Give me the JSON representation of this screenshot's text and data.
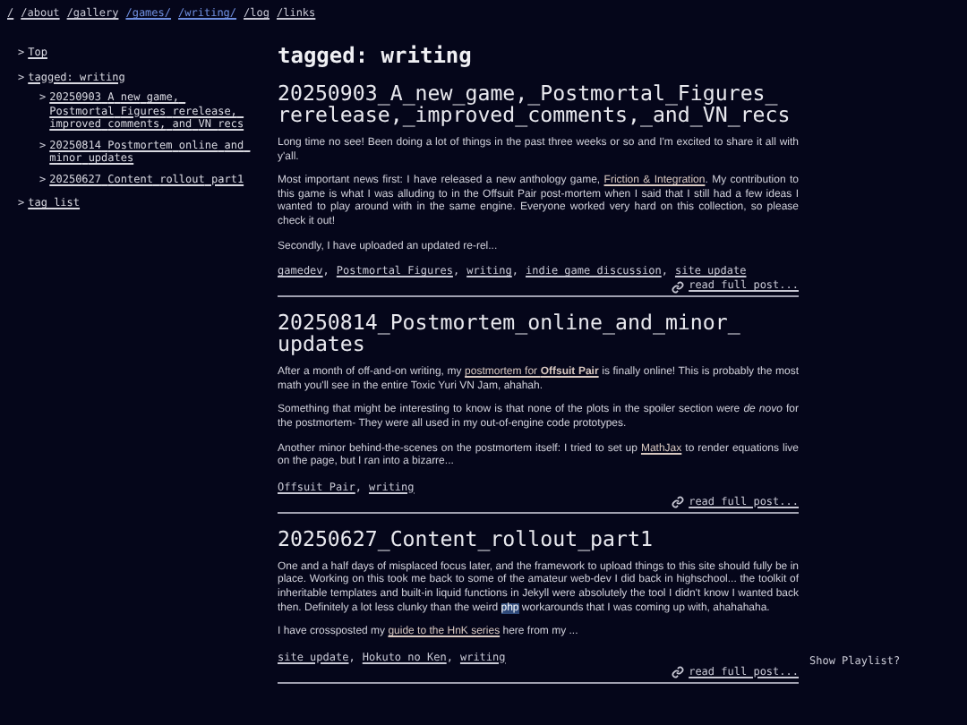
{
  "nav": [
    {
      "label": "/",
      "current": false
    },
    {
      "label": "/about",
      "current": false
    },
    {
      "label": "/gallery",
      "current": false
    },
    {
      "label": "/games/",
      "current": true
    },
    {
      "label": "/writing/",
      "current": true
    },
    {
      "label": "/log",
      "current": false
    },
    {
      "label": "/links",
      "current": false
    }
  ],
  "sidebar": {
    "items": [
      {
        "marker": ">",
        "label": "Top"
      },
      {
        "marker": ">",
        "label": "tagged: writing",
        "children": [
          {
            "marker": ">",
            "label": "20250903_A_new_game,_Postmortal_Figures_rerelease,_improved_comments,_and_VN_recs"
          },
          {
            "marker": ">",
            "label": "20250814_Postmortem_online_and_minor_updates"
          },
          {
            "marker": ">",
            "label": "20250627_Content_rollout_part1"
          }
        ]
      },
      {
        "marker": ">",
        "label": "tag list"
      }
    ]
  },
  "heading": "tagged: writing",
  "posts": [
    {
      "title": "20250903_A_new_game,_Postmortal_Figures_rerelease,_improved_comments,_and_VN_recs",
      "paragraphs": [
        [
          {
            "kind": "text",
            "text": "Long time no see! Been doing a lot of things in the past three weeks or so and I'm excited to share it all with y'all."
          }
        ],
        [
          {
            "kind": "text",
            "text": "Most important news first: I have released a new anthology game, "
          },
          {
            "kind": "link",
            "text": "Friction & Integration"
          },
          {
            "kind": "text",
            "text": ". My contribution to this game is what I was alluding to in the Offsuit Pair post-mortem when I said that I still had a few ideas I wanted to play around with in the same engine. Everyone worked very hard on this collection, so please check it out!"
          }
        ],
        [
          {
            "kind": "text",
            "text": "Secondly, I have uploaded an updated re-rel..."
          }
        ]
      ],
      "tags": [
        "gamedev",
        "Postmortal Figures",
        "writing",
        "indie game discussion",
        "site update"
      ],
      "tag_separator": ",",
      "read_more": "read full post..."
    },
    {
      "title": "20250814_Postmortem_online_and_minor_updates",
      "paragraphs": [
        [
          {
            "kind": "text",
            "text": "After a month of off-and-on writing, my "
          },
          {
            "kind": "link",
            "text": "postmortem for **Offsuit Pair**"
          },
          {
            "kind": "text",
            "text": " is finally online! This is probably the most math you'll see in the entire Toxic Yuri VN Jam, ahahah."
          }
        ],
        [
          {
            "kind": "text",
            "text": "Something that might be interesting to know is that none of the plots in the spoiler section were *de novo* for the postmortem- They were all used in my out-of-engine code prototypes."
          }
        ],
        [
          {
            "kind": "text",
            "text": "Another minor behind-the-scenes on the postmortem itself: I tried to set up "
          },
          {
            "kind": "link",
            "text": "MathJax"
          },
          {
            "kind": "text",
            "text": " to render equations live on the page, but I ran into a bizarre..."
          }
        ]
      ],
      "tags": [
        "Offsuit Pair",
        "writing"
      ],
      "tag_separator": ",",
      "read_more": "read full post..."
    },
    {
      "title": "20250627_Content_rollout_part1",
      "paragraphs": [
        [
          {
            "kind": "text",
            "text": "One and a half days of misplaced focus later, and the framework to upload things to this site should fully be in place. Working on this took me back to some of the amateur web-dev I did back in highschool... the toolkit of inheritable templates and built-in liquid functions in Jekyll were absolutely the tool I didn't know I wanted back then. Definitely a lot less clunky than the weird "
          },
          {
            "kind": "highlight",
            "text": "php"
          },
          {
            "kind": "text",
            "text": " workarounds that I was coming up with, ahahahaha."
          }
        ],
        [
          {
            "kind": "text",
            "text": "I have crossposted my "
          },
          {
            "kind": "link",
            "text": "guide to the HnK series"
          },
          {
            "kind": "text",
            "text": " here from my ..."
          }
        ]
      ],
      "tags": [
        "site update",
        "Hokuto no Ken",
        "writing"
      ],
      "tag_separator": ",",
      "read_more": "read full post..."
    }
  ],
  "playlist_toggle": "Show Playlist?"
}
